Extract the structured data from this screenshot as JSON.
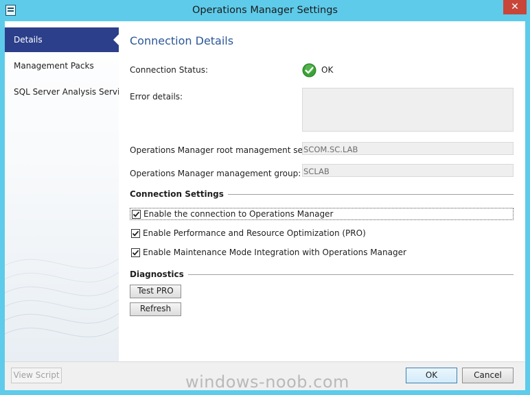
{
  "window": {
    "title": "Operations Manager Settings",
    "close_glyph": "✕",
    "icon": "app-icon"
  },
  "nav": {
    "items": [
      {
        "label": "Details",
        "selected": true
      },
      {
        "label": "Management Packs",
        "selected": false
      },
      {
        "label": "SQL Server Analysis Services",
        "selected": false
      }
    ]
  },
  "details": {
    "heading": "Connection Details",
    "connection_status_label": "Connection Status:",
    "connection_status_value": "OK",
    "status_icon": "check-circle-icon",
    "error_details_label": "Error details:",
    "error_details_value": "",
    "root_server_label": "Operations Manager root management server:",
    "root_server_value": "SCOM.SC.LAB",
    "group_label": "Operations Manager management group:",
    "group_value": "SCLAB"
  },
  "connection_settings": {
    "heading": "Connection Settings",
    "options": [
      {
        "label": "Enable the connection to Operations Manager",
        "checked": true
      },
      {
        "label": "Enable Performance and Resource Optimization (PRO)",
        "checked": true
      },
      {
        "label": "Enable Maintenance Mode Integration with Operations Manager",
        "checked": true
      }
    ]
  },
  "diagnostics": {
    "heading": "Diagnostics",
    "test_pro_label": "Test PRO",
    "refresh_label": "Refresh"
  },
  "footer": {
    "view_script_label": "View Script",
    "ok_label": "OK",
    "cancel_label": "Cancel",
    "watermark": "windows-noob.com"
  },
  "colors": {
    "title_bar": "#5ecbea",
    "nav_selected": "#2c3f8a",
    "heading_blue": "#2b5797",
    "close_button": "#c8453a",
    "status_ok": "#3aa335"
  }
}
